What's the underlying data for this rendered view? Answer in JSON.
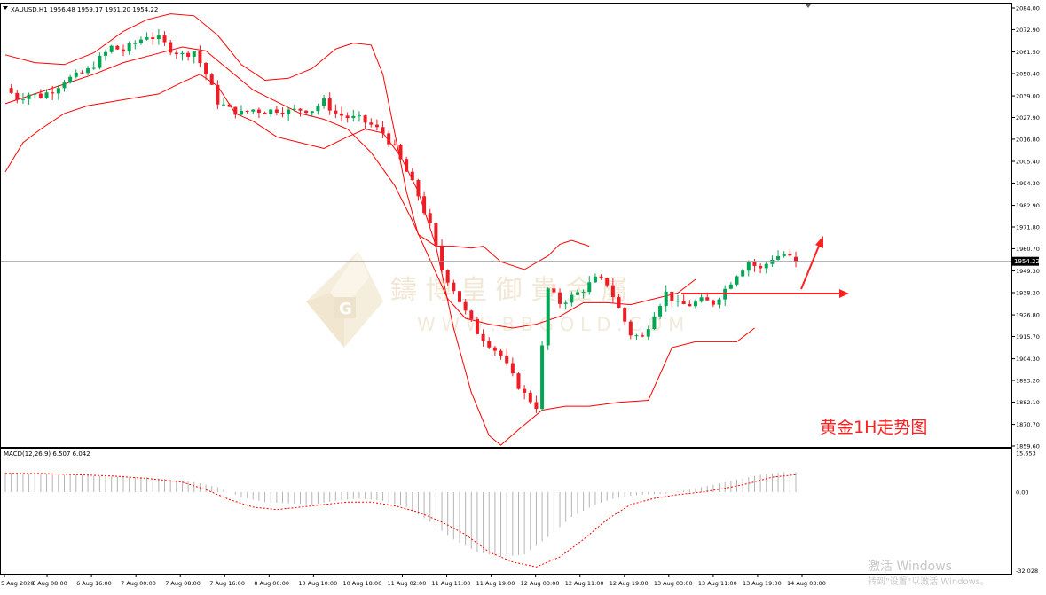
{
  "symbol_info": "XAUUSD,H1  1956.48 1959.17 1951.20 1954.22",
  "annotation": "黄金1H走势图",
  "watermark": {
    "cn": "鑄  博  皇  御  貴  金  屬",
    "en": "W W W . B B G O L D . C O M"
  },
  "windows_watermark": {
    "line1": "激活 Windows",
    "line2": "转到\"设置\"以激活 Windows。"
  },
  "colors": {
    "bull": "#00a651",
    "bear": "#ee1c25",
    "bands": "#ff0000",
    "macd_signal": "#ff0000",
    "macd_hist": "#b4b4b4",
    "annotation": "#ff0000"
  },
  "chart_data": [
    {
      "type": "candlestick",
      "symbol": "XAUUSD",
      "timeframe": "H1",
      "ohlc_last": {
        "open": 1956.48,
        "high": 1959.17,
        "low": 1951.2,
        "close": 1954.22
      },
      "current_price_label": "1954.22",
      "ylim": [
        1859.6,
        2084.0
      ],
      "yticks": [
        "2084.00",
        "2072.90",
        "2061.50",
        "2050.40",
        "2039.00",
        "2027.90",
        "2016.80",
        "2005.40",
        "1994.30",
        "1982.90",
        "1971.80",
        "1960.70",
        "1949.30",
        "1938.20",
        "1926.80",
        "1915.70",
        "1904.30",
        "1893.20",
        "1882.10",
        "1870.70",
        "1859.60"
      ],
      "xticks": [
        "5 Aug 2020",
        "6 Aug 08:00",
        "6 Aug 16:00",
        "7 Aug 00:00",
        "7 Aug 08:00",
        "7 Aug 16:00",
        "8 Aug 00:00",
        "10 Aug 10:00",
        "10 Aug 18:00",
        "11 Aug 02:00",
        "11 Aug 11:00",
        "11 Aug 19:00",
        "12 Aug 03:00",
        "12 Aug 11:00",
        "12 Aug 19:00",
        "13 Aug 03:00",
        "13 Aug 11:00",
        "13 Aug 19:00",
        "14 Aug 03:00"
      ],
      "indicators": [
        "Bollinger Bands (upper, middle, lower)"
      ],
      "close_path": [
        [
          0,
          2043
        ],
        [
          10,
          2038
        ],
        [
          20,
          2040
        ],
        [
          30,
          2039
        ],
        [
          40,
          2042
        ],
        [
          50,
          2047
        ],
        [
          60,
          2049
        ],
        [
          70,
          2052
        ],
        [
          80,
          2058
        ],
        [
          90,
          2064
        ],
        [
          100,
          2062
        ],
        [
          110,
          2066
        ],
        [
          120,
          2070
        ],
        [
          130,
          2068
        ],
        [
          140,
          2063
        ],
        [
          150,
          2060
        ],
        [
          160,
          2062
        ],
        [
          170,
          2050
        ],
        [
          180,
          2036
        ],
        [
          190,
          2032
        ],
        [
          200,
          2030
        ],
        [
          210,
          2032
        ],
        [
          220,
          2031
        ],
        [
          230,
          2032
        ],
        [
          240,
          2031
        ],
        [
          250,
          2032
        ],
        [
          260,
          2032
        ],
        [
          270,
          2036
        ],
        [
          280,
          2030
        ],
        [
          290,
          2028
        ],
        [
          300,
          2027
        ],
        [
          310,
          2024
        ],
        [
          320,
          2020
        ],
        [
          330,
          2012
        ],
        [
          340,
          2000
        ],
        [
          350,
          1988
        ],
        [
          360,
          1972
        ],
        [
          370,
          1950
        ],
        [
          380,
          1940
        ],
        [
          390,
          1928
        ],
        [
          400,
          1918
        ],
        [
          410,
          1912
        ],
        [
          420,
          1906
        ],
        [
          430,
          1895
        ],
        [
          440,
          1886
        ],
        [
          450,
          1880
        ],
        [
          460,
          1940
        ],
        [
          470,
          1933
        ],
        [
          480,
          1936
        ],
        [
          490,
          1940
        ],
        [
          500,
          1945
        ],
        [
          510,
          1943
        ],
        [
          520,
          1930
        ],
        [
          530,
          1917
        ],
        [
          540,
          1915
        ],
        [
          550,
          1928
        ],
        [
          560,
          1938
        ],
        [
          570,
          1932
        ],
        [
          580,
          1932
        ],
        [
          590,
          1934
        ],
        [
          600,
          1933
        ],
        [
          610,
          1940
        ],
        [
          620,
          1948
        ],
        [
          630,
          1954
        ],
        [
          640,
          1950
        ],
        [
          650,
          1956
        ],
        [
          660,
          1958
        ],
        [
          670,
          1954
        ]
      ],
      "bollinger": {
        "upper": [
          [
            0,
            2060
          ],
          [
            25,
            2056
          ],
          [
            50,
            2055
          ],
          [
            75,
            2061
          ],
          [
            100,
            2072
          ],
          [
            120,
            2078
          ],
          [
            140,
            2081
          ],
          [
            160,
            2080
          ],
          [
            180,
            2070
          ],
          [
            200,
            2055
          ],
          [
            220,
            2047
          ],
          [
            240,
            2048
          ],
          [
            260,
            2053
          ],
          [
            280,
            2063
          ],
          [
            295,
            2066
          ],
          [
            310,
            2065
          ],
          [
            320,
            2050
          ],
          [
            330,
            2020
          ],
          [
            340,
            1990
          ],
          [
            350,
            1968
          ],
          [
            365,
            1962
          ],
          [
            380,
            1962
          ],
          [
            395,
            1961
          ],
          [
            405,
            1962
          ],
          [
            420,
            1954
          ],
          [
            440,
            1950
          ],
          [
            460,
            1957
          ],
          [
            470,
            1963
          ],
          [
            480,
            1965
          ],
          [
            495,
            1962
          ]
        ],
        "middle": [
          [
            0,
            2035
          ],
          [
            25,
            2040
          ],
          [
            50,
            2045
          ],
          [
            75,
            2050
          ],
          [
            100,
            2056
          ],
          [
            125,
            2060
          ],
          [
            150,
            2064
          ],
          [
            170,
            2062
          ],
          [
            190,
            2052
          ],
          [
            210,
            2042
          ],
          [
            230,
            2036
          ],
          [
            250,
            2030
          ],
          [
            270,
            2027
          ],
          [
            290,
            2022
          ],
          [
            310,
            2010
          ],
          [
            330,
            1993
          ],
          [
            345,
            1975
          ],
          [
            360,
            1955
          ],
          [
            375,
            1935
          ],
          [
            390,
            1925
          ],
          [
            410,
            1922
          ],
          [
            430,
            1920
          ],
          [
            450,
            1922
          ],
          [
            470,
            1926
          ],
          [
            490,
            1933
          ],
          [
            510,
            1933
          ],
          [
            530,
            1932
          ],
          [
            550,
            1935
          ],
          [
            570,
            1938
          ],
          [
            585,
            1945
          ]
        ],
        "lower": [
          [
            0,
            2000
          ],
          [
            15,
            2015
          ],
          [
            30,
            2022
          ],
          [
            50,
            2030
          ],
          [
            70,
            2034
          ],
          [
            90,
            2036
          ],
          [
            110,
            2038
          ],
          [
            130,
            2040
          ],
          [
            150,
            2046
          ],
          [
            165,
            2050
          ],
          [
            180,
            2044
          ],
          [
            195,
            2030
          ],
          [
            210,
            2026
          ],
          [
            230,
            2018
          ],
          [
            250,
            2015
          ],
          [
            270,
            2012
          ],
          [
            290,
            2018
          ],
          [
            305,
            2022
          ],
          [
            320,
            2020
          ],
          [
            335,
            2008
          ],
          [
            350,
            1990
          ],
          [
            365,
            1962
          ],
          [
            380,
            1920
          ],
          [
            395,
            1887
          ],
          [
            410,
            1865
          ],
          [
            420,
            1860
          ],
          [
            435,
            1868
          ],
          [
            455,
            1878
          ],
          [
            475,
            1880
          ],
          [
            495,
            1880
          ],
          [
            520,
            1882
          ],
          [
            545,
            1883
          ],
          [
            565,
            1910
          ],
          [
            585,
            1913
          ],
          [
            605,
            1913
          ],
          [
            620,
            1913
          ],
          [
            635,
            1920
          ]
        ]
      }
    },
    {
      "type": "bar+line",
      "indicator": "MACD",
      "params_label": "MACD(12,26,9) 6.507 6.042",
      "macd": 6.507,
      "signal": 6.042,
      "ylim": [
        -32.028,
        15.653
      ],
      "yticks": [
        "15.653",
        "0.00",
        "-32.028"
      ],
      "histogram_path": [
        [
          0,
          8
        ],
        [
          20,
          7.5
        ],
        [
          40,
          7
        ],
        [
          60,
          6.8
        ],
        [
          80,
          6.5
        ],
        [
          100,
          6.2
        ],
        [
          120,
          6
        ],
        [
          140,
          5
        ],
        [
          160,
          4
        ],
        [
          180,
          2
        ],
        [
          190,
          0
        ],
        [
          200,
          -2
        ],
        [
          220,
          -4
        ],
        [
          240,
          -4.5
        ],
        [
          260,
          -5
        ],
        [
          280,
          -3.5
        ],
        [
          300,
          -2.5
        ],
        [
          320,
          -3.5
        ],
        [
          340,
          -6
        ],
        [
          360,
          -12
        ],
        [
          380,
          -19
        ],
        [
          400,
          -24
        ],
        [
          420,
          -26
        ],
        [
          440,
          -25
        ],
        [
          460,
          -18
        ],
        [
          480,
          -10
        ],
        [
          500,
          -5
        ],
        [
          520,
          -2
        ],
        [
          540,
          -1
        ],
        [
          560,
          -0.5
        ],
        [
          580,
          1
        ],
        [
          600,
          3
        ],
        [
          620,
          5
        ],
        [
          640,
          7
        ],
        [
          660,
          8
        ],
        [
          670,
          8
        ]
      ],
      "signal_path": [
        [
          0,
          7.5
        ],
        [
          30,
          7.5
        ],
        [
          60,
          7
        ],
        [
          90,
          6.5
        ],
        [
          120,
          5.5
        ],
        [
          150,
          4
        ],
        [
          170,
          1
        ],
        [
          190,
          -3
        ],
        [
          210,
          -6
        ],
        [
          230,
          -7
        ],
        [
          250,
          -6
        ],
        [
          270,
          -5
        ],
        [
          290,
          -4
        ],
        [
          310,
          -4
        ],
        [
          330,
          -5.5
        ],
        [
          350,
          -8
        ],
        [
          370,
          -12
        ],
        [
          390,
          -17
        ],
        [
          410,
          -24
        ],
        [
          430,
          -28
        ],
        [
          450,
          -30
        ],
        [
          470,
          -26
        ],
        [
          490,
          -19
        ],
        [
          510,
          -11
        ],
        [
          530,
          -5
        ],
        [
          550,
          -2.5
        ],
        [
          570,
          -1
        ],
        [
          590,
          0
        ],
        [
          610,
          1.5
        ],
        [
          630,
          3.5
        ],
        [
          650,
          6
        ],
        [
          670,
          7
        ]
      ]
    }
  ]
}
